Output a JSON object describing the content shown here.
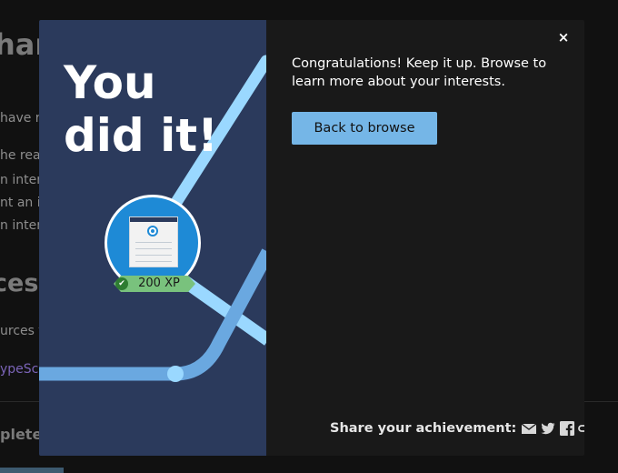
{
  "background_page": {
    "title_fragment": "har",
    "line1": "have re",
    "line2": "he reas",
    "line3": "n inter",
    "line4": "nt an i",
    "line5": "n inter",
    "heading_fragment": "ces",
    "line6": "urces f",
    "link_fragment": "ypeSc",
    "bottom_fragment": "plete:"
  },
  "modal": {
    "headline_line1": "You",
    "headline_line2": "did it!",
    "badge": {
      "xp_label": "200 XP",
      "check_icon": "check-icon"
    },
    "close_label": "×",
    "message": "Congratulations! Keep it up. Browse to learn more about your interests.",
    "back_button_label": "Back to browse",
    "share_label": "Share your achievement:",
    "share_icons": [
      "email-icon",
      "twitter-icon",
      "facebook-icon",
      "link-icon"
    ]
  },
  "colors": {
    "modal_left_bg": "#2b3a5c",
    "modal_right_bg": "#191919",
    "track_light": "#9ad8ff",
    "track_mid": "#6aa8e0",
    "badge_blue": "#1e8ad6",
    "xp_green": "#79c27d",
    "button_blue": "#75b6e7"
  }
}
